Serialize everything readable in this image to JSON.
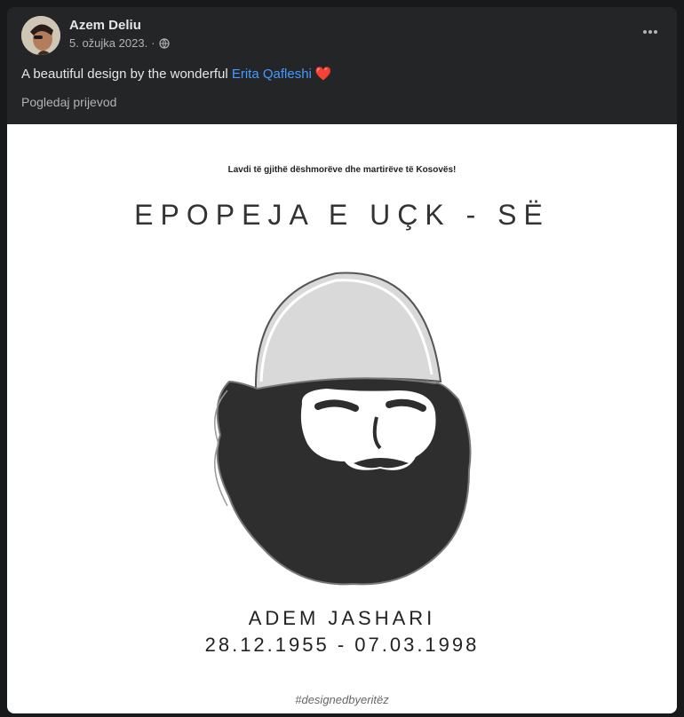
{
  "post": {
    "author": "Azem Deliu",
    "date": "5. ožujka 2023.",
    "dot": "·",
    "privacy_icon": "globe-icon",
    "more_icon": "more-options-icon",
    "caption_text": "A beautiful design by the wonderful ",
    "caption_mention": "Erita Qafleshi",
    "caption_emoji": "❤️",
    "translate_link": "Pogledaj prijevod"
  },
  "image": {
    "tagline": "Lavdi të gjithë dëshmorëve dhe martirëve të Kosovës!",
    "title": "EPOPEJA E UÇK - SË",
    "name": "ADEM JASHARI",
    "dates": "28.12.1955 - 07.03.1998",
    "credit": "#designedbyeritëz"
  },
  "colors": {
    "background": "#18191a",
    "card": "#242526",
    "text_primary": "#e4e6eb",
    "text_secondary": "#b0b3b8",
    "link": "#4599ff",
    "heart": "#f02849"
  }
}
